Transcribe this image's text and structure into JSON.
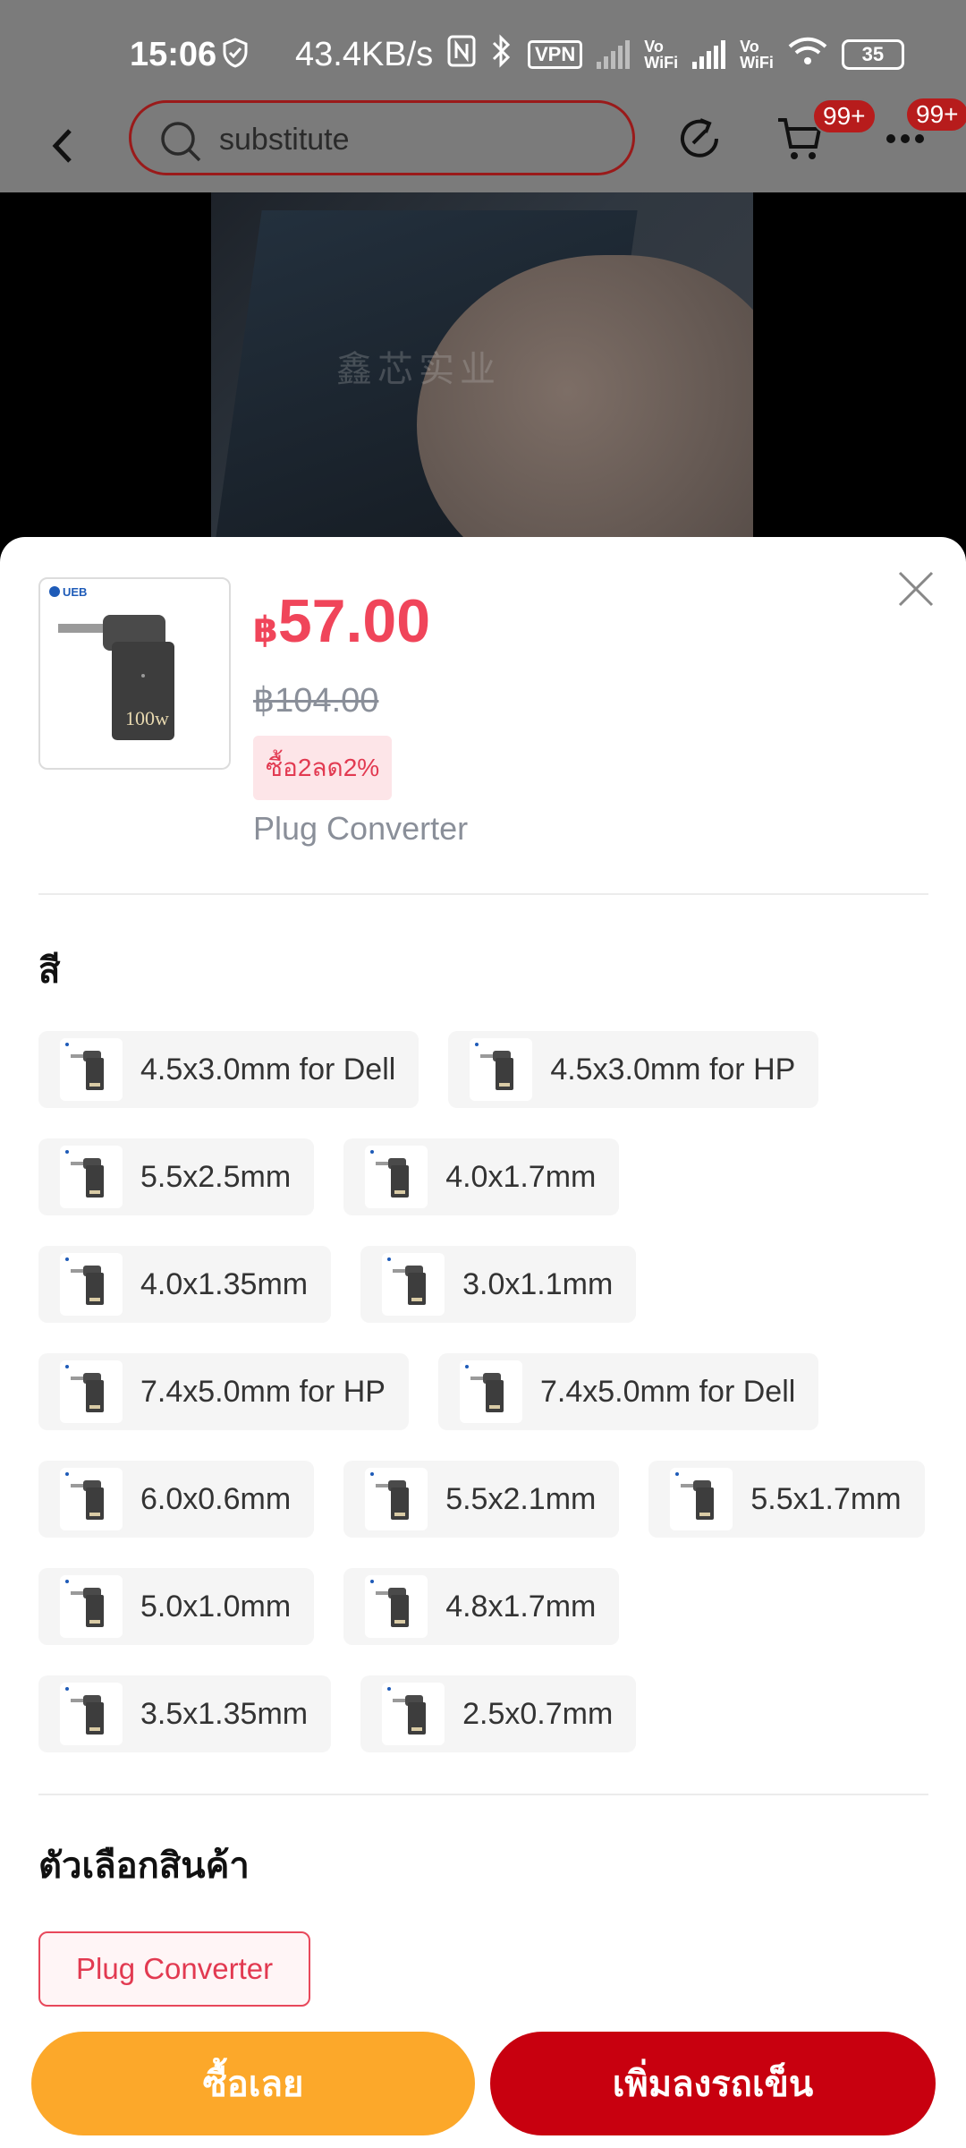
{
  "status_bar": {
    "time": "15:06",
    "net_speed": "43.4KB/s",
    "vpn": "VPN",
    "vo_wifi": "Vo\nWiFi",
    "battery": "35"
  },
  "nav": {
    "search_text": "substitute",
    "cart_badge": "99+",
    "more_badge": "99+"
  },
  "video": {
    "watermark": "鑫芯实业"
  },
  "product": {
    "currency": "฿",
    "price": "57.00",
    "original_price": "฿104.00",
    "promo": "ซื้อ2ลด2%",
    "selected_variant": "Plug Converter",
    "thumb_brand": "UEB",
    "thumb_power": "100w"
  },
  "color_section": {
    "title": "สี",
    "options": [
      [
        "4.5x3.0mm for Dell",
        "4.5x3.0mm for HP"
      ],
      [
        "5.5x2.5mm",
        "4.0x1.7mm"
      ],
      [
        "4.0x1.35mm",
        "3.0x1.1mm"
      ],
      [
        "7.4x5.0mm for HP",
        "7.4x5.0mm for Dell"
      ],
      [
        "6.0x0.6mm",
        "5.5x2.1mm",
        "5.5x1.7mm"
      ],
      [
        "5.0x1.0mm",
        "4.8x1.7mm"
      ],
      [
        "3.5x1.35mm",
        "2.5x0.7mm"
      ]
    ]
  },
  "variant_section": {
    "title": "ตัวเลือกสินค้า",
    "option": "Plug Converter"
  },
  "buttons": {
    "buy_now": "ซื้อเลย",
    "add_to_cart": "เพิ่มลงรถเข็น"
  },
  "colors": {
    "price_red": "#f0455a",
    "buy_orange": "#fca82a",
    "cart_red": "#c8000f"
  }
}
